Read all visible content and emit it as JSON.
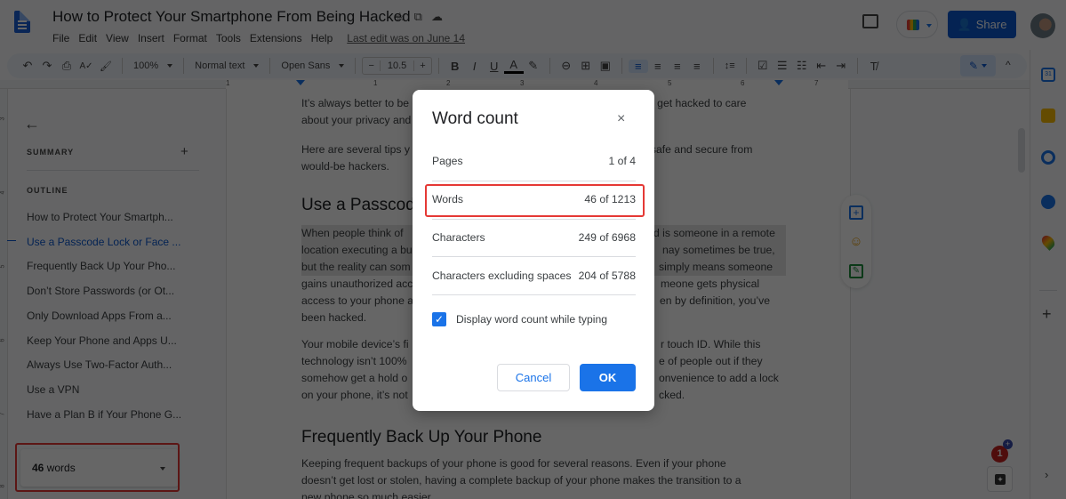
{
  "header": {
    "doc_title": "How to Protect Your Smartphone From Being Hacked",
    "title_icons": [
      "star-icon",
      "move-to-folder-icon",
      "cloud-saved-icon"
    ],
    "menu": [
      "File",
      "Edit",
      "View",
      "Insert",
      "Format",
      "Tools",
      "Extensions",
      "Help"
    ],
    "last_edit": "Last edit was on June 14",
    "share_label": "Share",
    "meet_label": "Meet"
  },
  "toolbar": {
    "zoom": "100%",
    "style": "Normal text",
    "font": "Open Sans",
    "font_size": "10.5",
    "minus": "−",
    "plus": "+",
    "icons": {
      "undo": "↶",
      "redo": "↷",
      "print": "⎙",
      "spellcheck": "A✓",
      "paint": "🖌",
      "bold": "B",
      "italic": "I",
      "underline": "U",
      "text_color": "A",
      "highlight": "✎",
      "link": "⊖",
      "comment": "⊞",
      "image": "▣",
      "align_left": "≡",
      "align_center": "≡",
      "align_right": "≡",
      "justify": "≡",
      "line_spacing": "↕≡",
      "checklist": "☑",
      "bullets": "☰",
      "numbered": "☷",
      "indent_less": "⇤",
      "indent_more": "⇥",
      "clear_format": "T̸",
      "edit_mode": "✎",
      "collapse": "^"
    }
  },
  "ruler": {
    "h_numbers": [
      "1",
      "1",
      "2",
      "3",
      "4",
      "5",
      "6",
      "7"
    ],
    "v_numbers": [
      "3",
      "4",
      "5",
      "6",
      "7",
      "8"
    ]
  },
  "sidebar": {
    "back": "←",
    "summary_label": "SUMMARY",
    "summary_add": "+",
    "outline_label": "OUTLINE",
    "outline": [
      {
        "label": "How to Protect Your Smartph...",
        "active": false
      },
      {
        "label": "Use a Passcode Lock or Face ...",
        "active": true
      },
      {
        "label": "Frequently Back Up Your Pho...",
        "active": false
      },
      {
        "label": "Don’t Store Passwords (or Ot...",
        "active": false
      },
      {
        "label": "Only Download Apps From a...",
        "active": false
      },
      {
        "label": "Keep Your Phone and Apps U...",
        "active": false
      },
      {
        "label": "Always Use Two-Factor Auth...",
        "active": false
      },
      {
        "label": "Use a VPN",
        "active": false
      },
      {
        "label": "Have a Plan B if Your Phone G...",
        "active": false
      }
    ],
    "word_count_number": "46",
    "word_count_unit": " words"
  },
  "document": {
    "p1": "It’s always better to be proactive about your security than wait until you get hacked to care about your privacy and security.",
    "p1_line1": "It’s always better to be",
    "p1_line1_end": "u get hacked to care",
    "p1_line2": "about your privacy and",
    "p2_line1": "Here are several tips y",
    "p2_line1_end": "in safe and secure from",
    "p2_line2": "would-be hackers.",
    "h1": "Use a Passcode",
    "p3_lines_left": [
      "When people think of",
      "location executing a bu",
      "but the reality can som",
      "gains unauthorized acc",
      "access to your phone a",
      "been hacked."
    ],
    "p3_lines_right": [
      "d is someone in a remote",
      "nay sometimes be true,",
      "simply means someone",
      "meone gets physical",
      "en by definition, you’ve",
      ""
    ],
    "p4_lines_left": [
      "Your mobile device’s fi",
      "technology isn’t 100%",
      "somehow get a hold o",
      "on your phone, it’s not"
    ],
    "p4_lines_right": [
      "r touch ID. While this",
      "e of people out if they",
      "onvenience to add a lock",
      "cked."
    ],
    "h2": "Frequently Back Up Your Phone",
    "p5_lines": [
      "Keeping frequent backups of your phone is good for several reasons. Even if your phone",
      "doesn’t get lost or stolen, having a complete backup of your phone makes the transition to a",
      "new phone so much easier."
    ]
  },
  "dialog": {
    "title": "Word count",
    "close": "×",
    "stats": [
      {
        "label": "Pages",
        "value": "1 of 4"
      },
      {
        "label": "Words",
        "value": "46 of 1213"
      },
      {
        "label": "Characters",
        "value": "249 of 6968"
      },
      {
        "label": "Characters excluding spaces",
        "value": "204 of 5788"
      }
    ],
    "checkbox_label": "Display word count while typing",
    "checkbox_checked": true,
    "check_glyph": "✓",
    "cancel_label": "Cancel",
    "ok_label": "OK"
  },
  "right_panel": {
    "apps": [
      "calendar-icon",
      "keep-icon",
      "tasks-icon",
      "contacts-icon",
      "maps-icon"
    ],
    "calendar_day": "31",
    "add": "+",
    "expand": "›"
  },
  "notifications": {
    "count": "1",
    "plus": "+"
  },
  "colors": {
    "accent": "#1a73e8",
    "share": "#0b57d0",
    "highlight_outline": "#e53935"
  }
}
